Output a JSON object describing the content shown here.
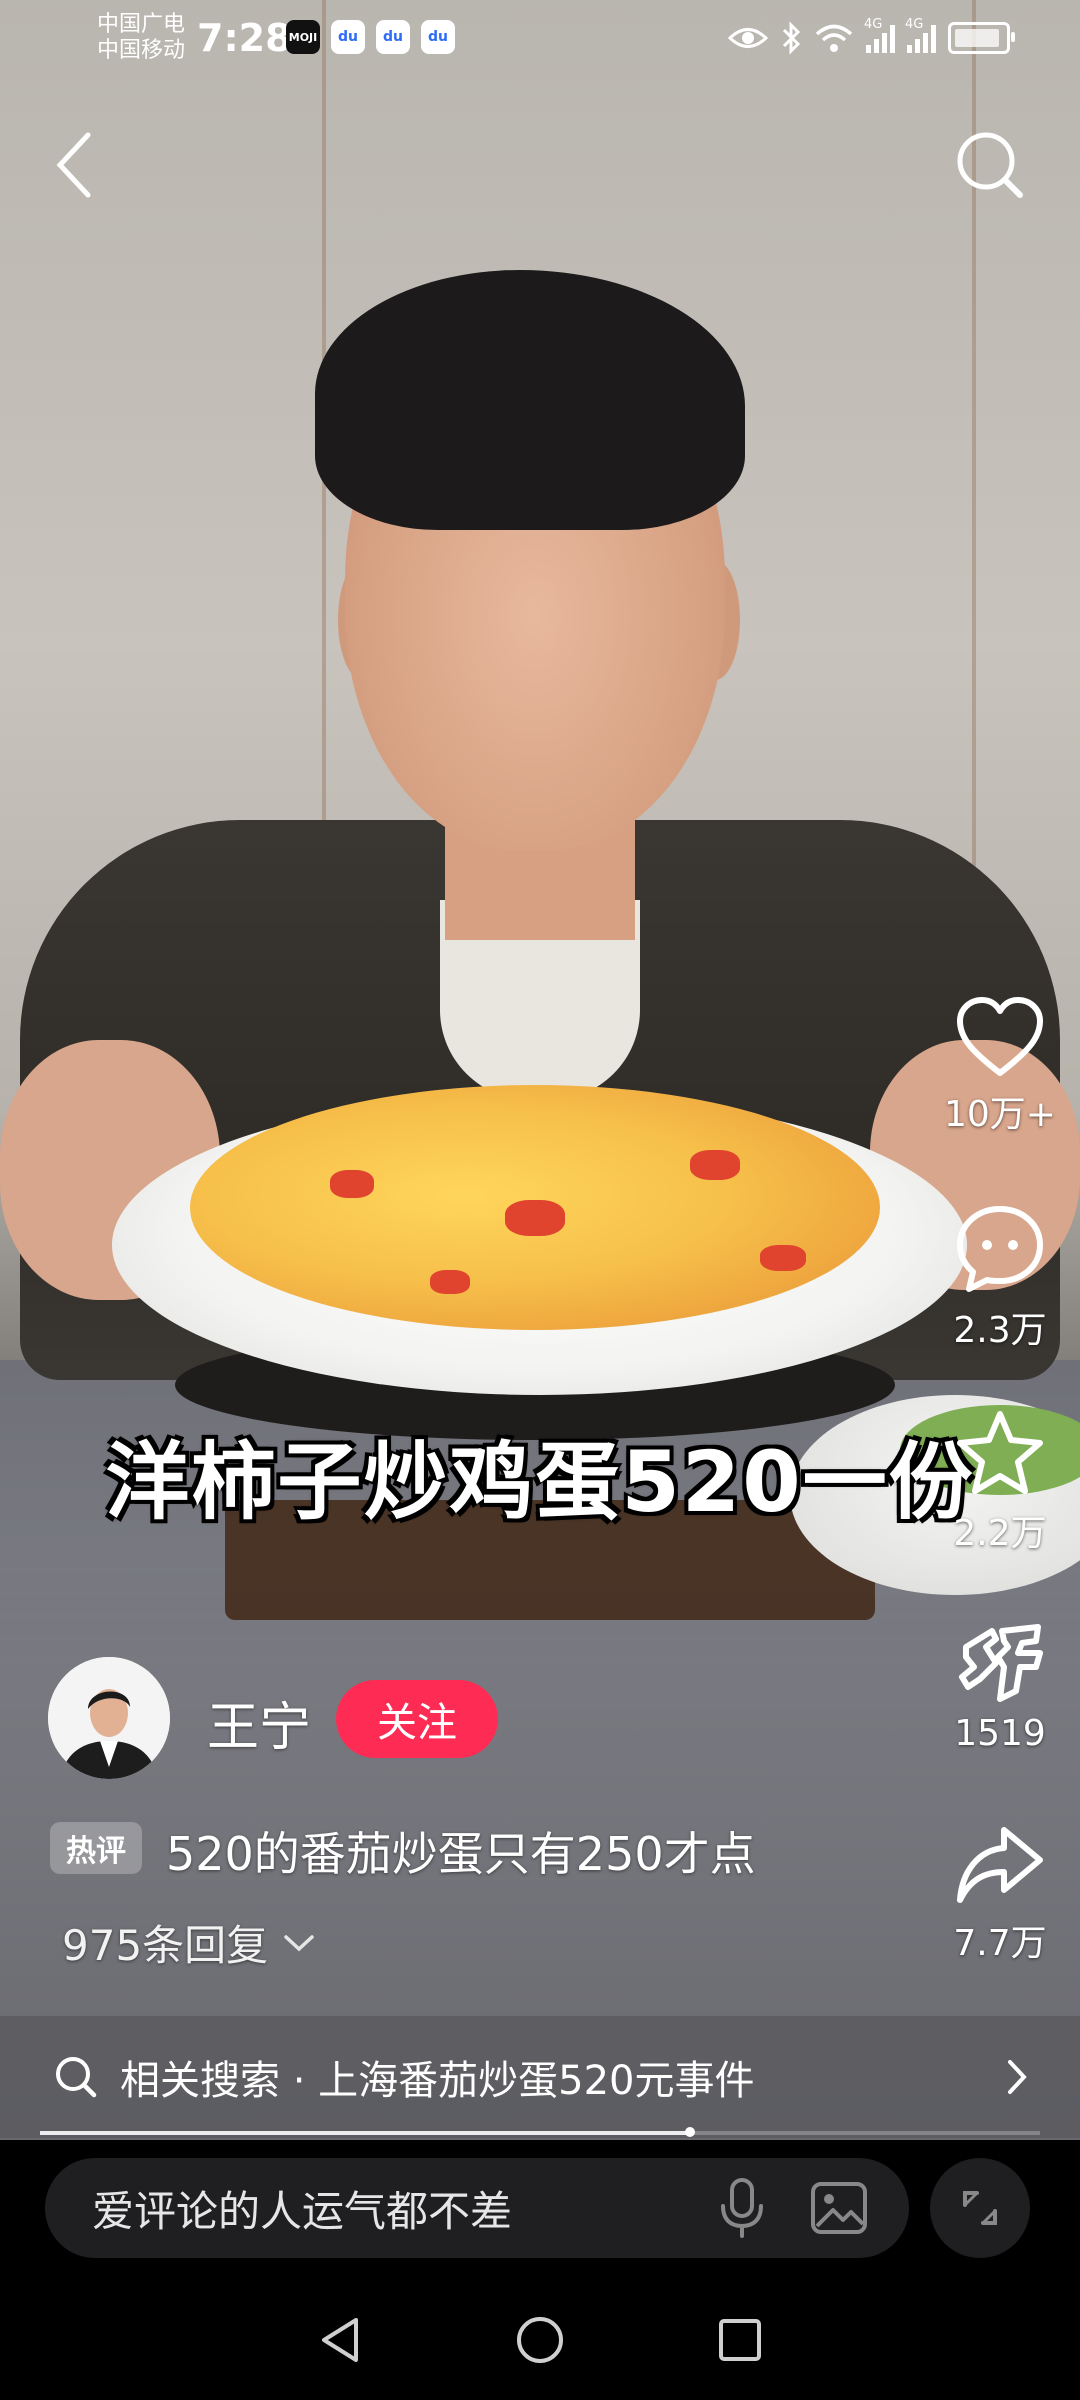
{
  "status_bar": {
    "carrier_1": "中国广电",
    "carrier_2": "中国移动",
    "time": "7:28",
    "app_icon_moji": "MOJI",
    "app_icon_du": "du",
    "network_1": "4G",
    "network_2": "4G"
  },
  "video": {
    "caption": "洋柿子炒鸡蛋520一份"
  },
  "actions": {
    "like_count": "10万+",
    "comment_count": "2.3万",
    "favorite_count": "2.2万",
    "good_count": "1519",
    "share_count": "7.7万"
  },
  "author": {
    "name": "王宁",
    "follow_label": "关注"
  },
  "hot_comment": {
    "tag": "热评",
    "text": "520的番茄炒蛋只有250才点",
    "replies": "975条回复"
  },
  "related_search": {
    "label": "相关搜索 · 上海番茄炒蛋520元事件"
  },
  "playback": {
    "progress": 0.65
  },
  "comment_input": {
    "placeholder": "爱评论的人运气都不差"
  },
  "colors": {
    "follow_button": "#fe2c55",
    "related_bar": "#5a5a5f",
    "input_bg": "#1f1f21"
  },
  "icons": [
    "back-icon",
    "search-icon",
    "heart-icon",
    "comment-icon",
    "star-icon",
    "good-icon",
    "share-icon",
    "chevron-down-icon",
    "chevron-right-icon",
    "mic-icon",
    "image-icon",
    "expand-icon",
    "nav-back-icon",
    "nav-home-icon",
    "nav-recents-icon"
  ]
}
